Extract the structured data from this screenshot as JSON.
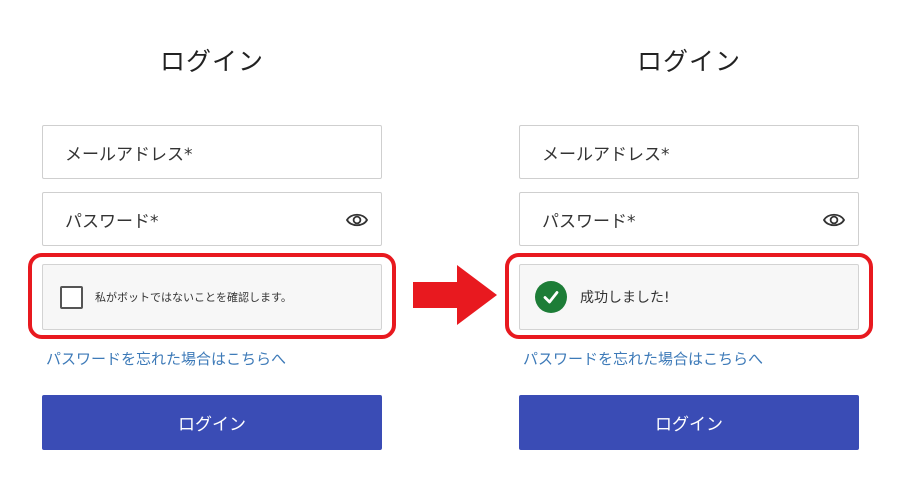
{
  "before": {
    "title": "ログイン",
    "email_placeholder": "メールアドレス*",
    "password_placeholder": "パスワード*",
    "captcha_label": "私がボットではないことを確認します。",
    "forgot_link": "パスワードを忘れた場合はこちらへ",
    "login_button": "ログイン"
  },
  "after": {
    "title": "ログイン",
    "email_placeholder": "メールアドレス*",
    "password_placeholder": "パスワード*",
    "captcha_success": "成功しました!",
    "forgot_link": "パスワードを忘れた場合はこちらへ",
    "login_button": "ログイン"
  },
  "colors": {
    "highlight": "#e8191f",
    "button": "#3a4cb5",
    "link": "#3d7ab8",
    "success": "#1d7d37"
  },
  "icons": {
    "password_toggle": "eye-icon",
    "transition": "right-arrow-icon",
    "success": "checkmark-circle-icon"
  }
}
